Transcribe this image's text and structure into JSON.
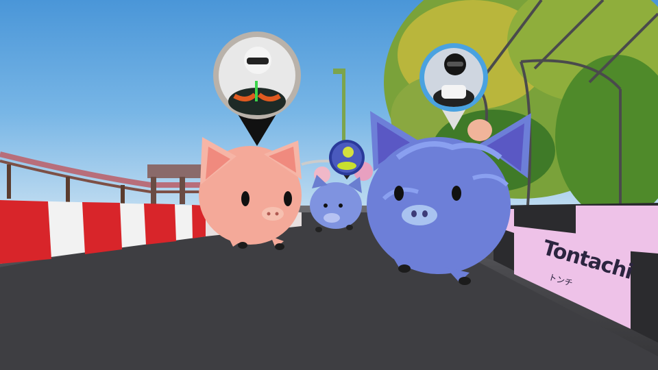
{
  "game": {
    "sponsor_banner": {
      "brand_name": "Tontachi",
      "brand_subtitle": "トンチ"
    },
    "racers": [
      {
        "name": "pink-pig-racer",
        "avatar": "helmet-racer-green-suit",
        "pin_style": "silver-dark"
      },
      {
        "name": "blue-pig-racer",
        "avatar": "helmet-racer-black-white",
        "pin_style": "blue-white"
      },
      {
        "name": "small-blue-pig-racer",
        "avatar": "helmet-racer-yellow",
        "pin_style": "small-blue"
      }
    ],
    "colors": {
      "pink_pig": "#f4a999",
      "blue_pig": "#6d7fd8",
      "barrier_red": "#d8252a",
      "barrier_white": "#f2f2f2",
      "banner_pink": "#eec2e8"
    }
  }
}
